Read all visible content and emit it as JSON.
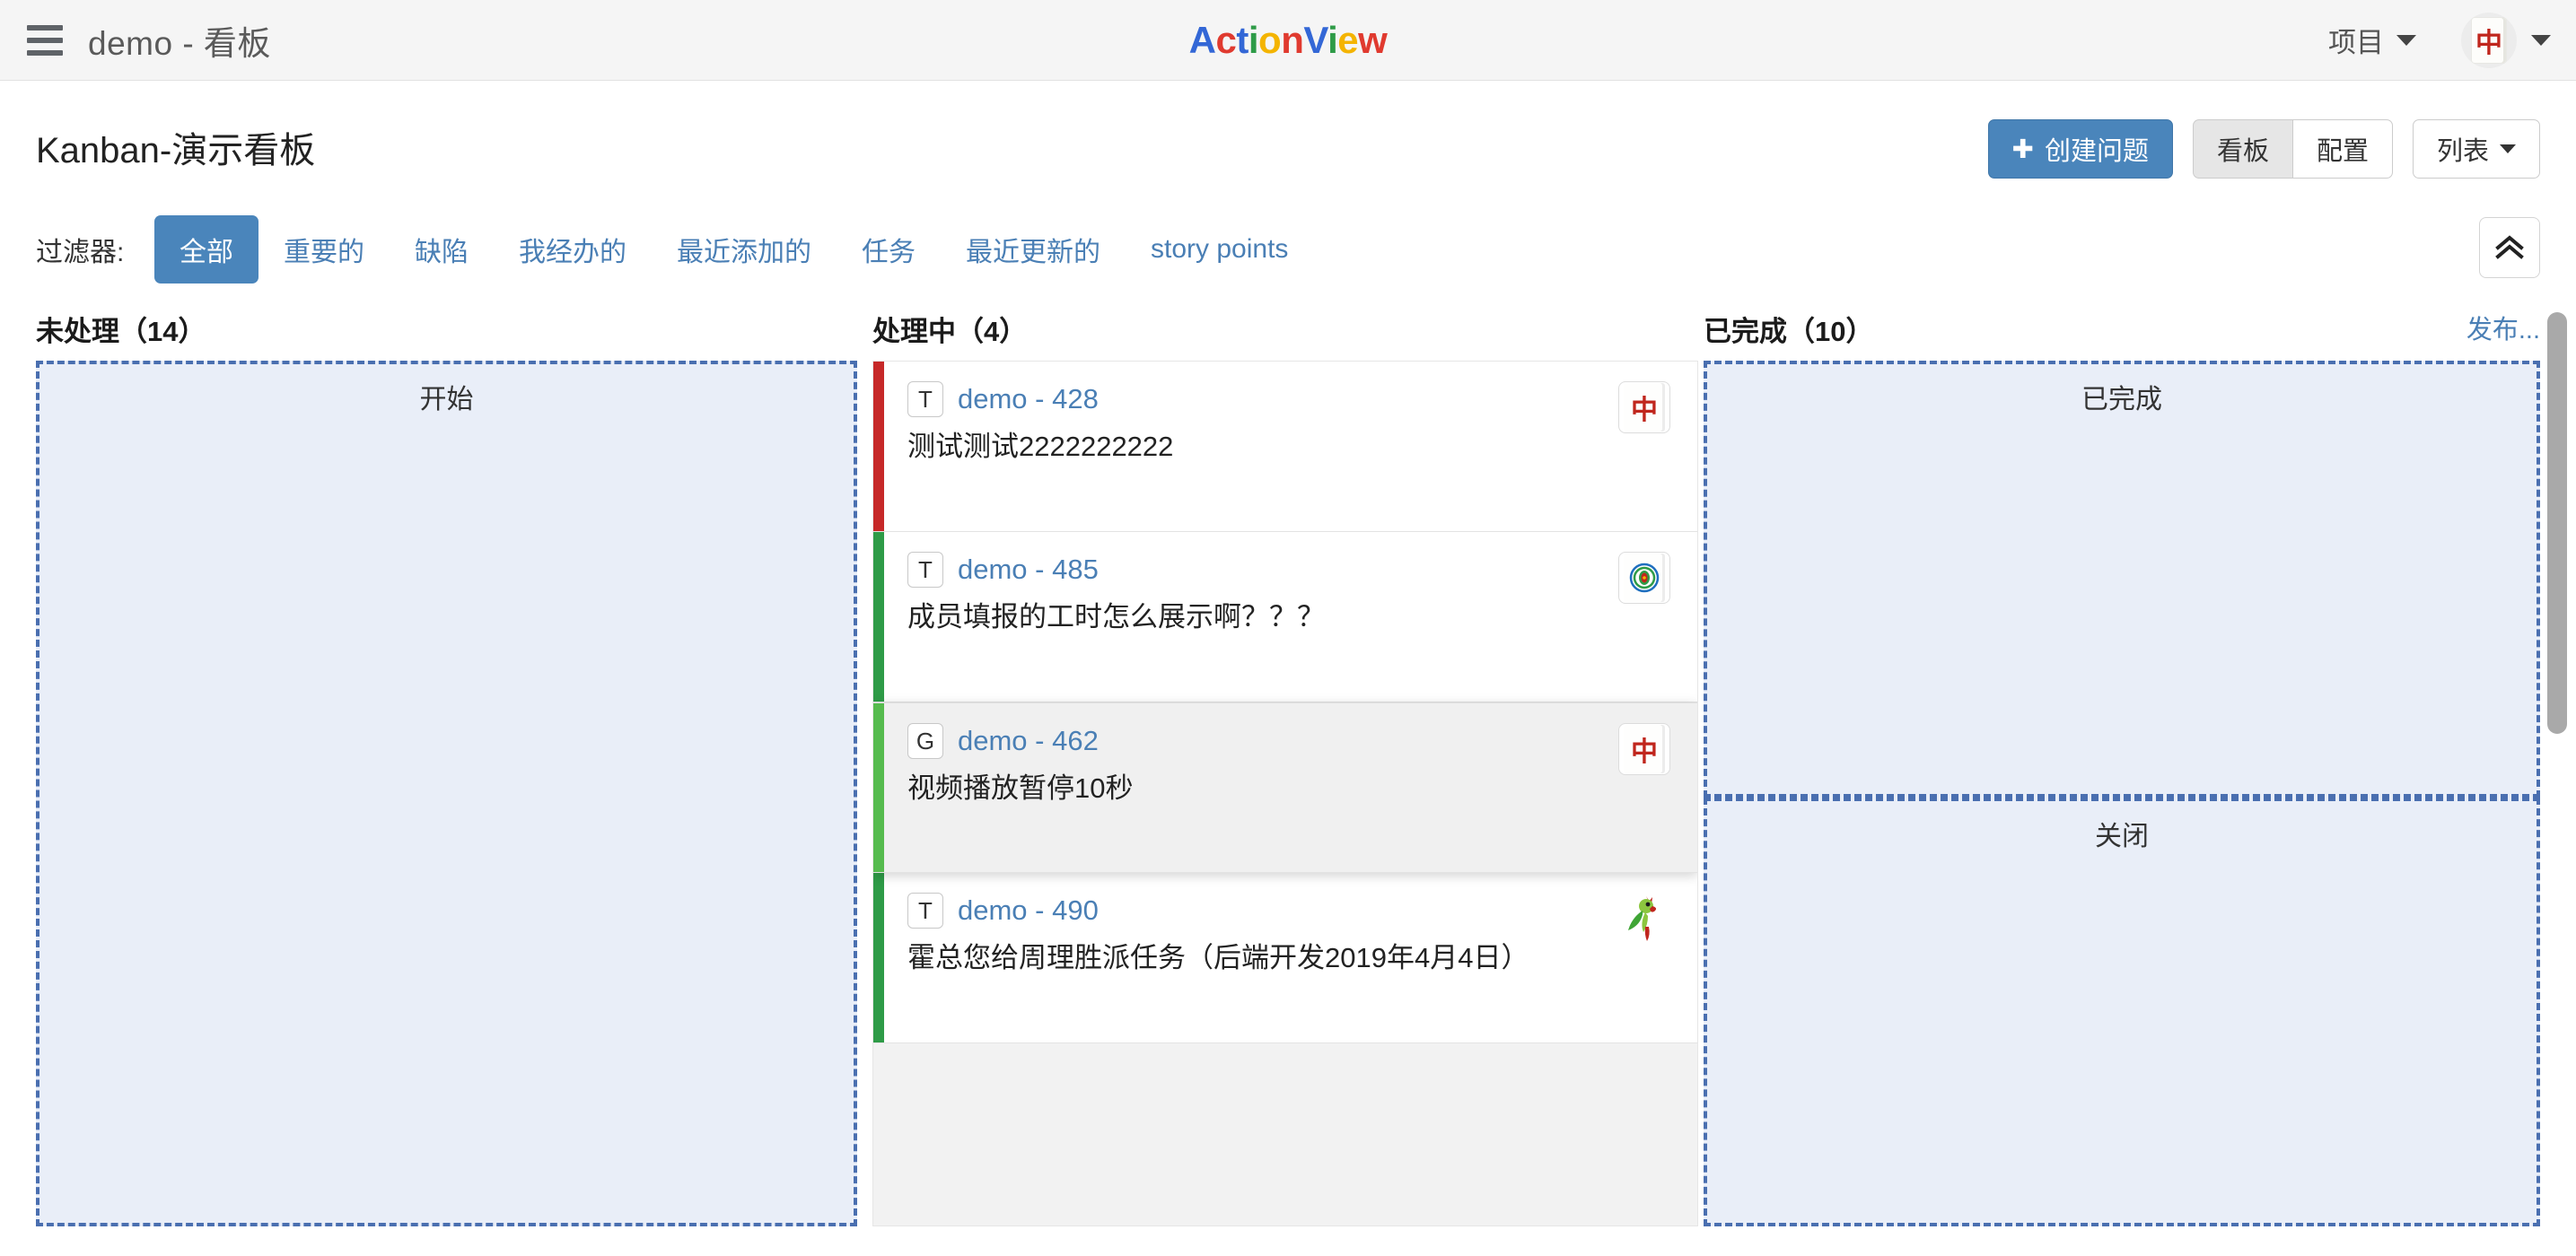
{
  "header": {
    "menu_icon": "hamburger-icon",
    "app_title": "demo - 看板",
    "logo": {
      "letters": [
        {
          "ch": "A",
          "color": "#3367d6"
        },
        {
          "ch": "c",
          "color": "#e03a2f"
        },
        {
          "ch": "t",
          "color": "#3367d6"
        },
        {
          "ch": "i",
          "color": "#2e9b47"
        },
        {
          "ch": "o",
          "color": "#f4b400"
        },
        {
          "ch": "n",
          "color": "#e03a2f"
        },
        {
          "ch": "V",
          "color": "#3367d6"
        },
        {
          "ch": "i",
          "color": "#2e9b47"
        },
        {
          "ch": "e",
          "color": "#f4b400"
        },
        {
          "ch": "w",
          "color": "#e03a2f"
        }
      ]
    },
    "project_menu": "项目",
    "avatar_glyph": "中"
  },
  "title_row": {
    "page_title": "Kanban-演示看板",
    "create_button": "创建问题",
    "create_icon": "plus-icon",
    "view_buttons": [
      {
        "label": "看板",
        "active": true
      },
      {
        "label": "配置",
        "active": false
      }
    ],
    "list_menu": "列表"
  },
  "filters": {
    "label": "过滤器:",
    "tabs": [
      {
        "label": "全部",
        "selected": true
      },
      {
        "label": "重要的",
        "selected": false
      },
      {
        "label": "缺陷",
        "selected": false
      },
      {
        "label": "我经办的",
        "selected": false
      },
      {
        "label": "最近添加的",
        "selected": false
      },
      {
        "label": "任务",
        "selected": false
      },
      {
        "label": "最近更新的",
        "selected": false
      },
      {
        "label": "story points",
        "selected": false
      }
    ],
    "collapse_icon": "chevron-double-up-icon"
  },
  "board": {
    "columns": [
      {
        "title": "未处理（14）",
        "dropzones": [
          {
            "label": "开始"
          }
        ]
      },
      {
        "title": "处理中（4）",
        "cards": [
          {
            "type": "T",
            "key": "demo - 428",
            "summary": "测试测试2222222222",
            "stripe": "#c62828",
            "avatar": "mahjong-red-dragon"
          },
          {
            "type": "T",
            "key": "demo - 485",
            "summary": "成员填报的工时怎么展示啊？？？",
            "stripe": "#2e9b47",
            "avatar": "mahjong-flower"
          },
          {
            "type": "G",
            "key": "demo - 462",
            "summary": "视频播放暂停10秒",
            "stripe": "#56bb4e",
            "avatar": "mahjong-red-dragon",
            "hover": true
          },
          {
            "type": "T",
            "key": "demo - 490",
            "summary": "霍总您给周理胜派任务（后端开发2019年4月4日）",
            "stripe": "#2e9b47",
            "avatar": "parrot"
          }
        ]
      },
      {
        "title": "已完成（10）",
        "link": "发布...",
        "dropzones": [
          {
            "label": "已完成"
          },
          {
            "label": "关闭"
          }
        ]
      }
    ]
  },
  "colors": {
    "accent": "#4a85bb",
    "link": "#4a7fb5",
    "dropzone_fill": "#e9eef8",
    "dropzone_border": "#4a6fb0"
  }
}
